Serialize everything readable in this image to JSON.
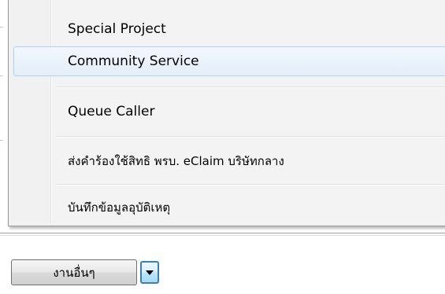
{
  "menu": {
    "items": [
      {
        "label": "Special Project",
        "highlighted": false
      },
      {
        "label": "Community Service",
        "highlighted": true
      },
      {
        "label": "Queue Caller",
        "highlighted": false
      },
      {
        "label": "ส่งคำร้องใช้สิทธิ พรบ. eClaim บริษัทกลาง",
        "highlighted": false
      },
      {
        "label": "บันทึกข้อมูลอุบัติเหตุ",
        "highlighted": false
      }
    ]
  },
  "toolbar": {
    "main_button_label": "งานอื่นๆ",
    "dropdown_icon": "chevron-down-icon"
  },
  "colors": {
    "highlight_border": "#aecff7",
    "dropdown_border": "#3c7fb1"
  }
}
